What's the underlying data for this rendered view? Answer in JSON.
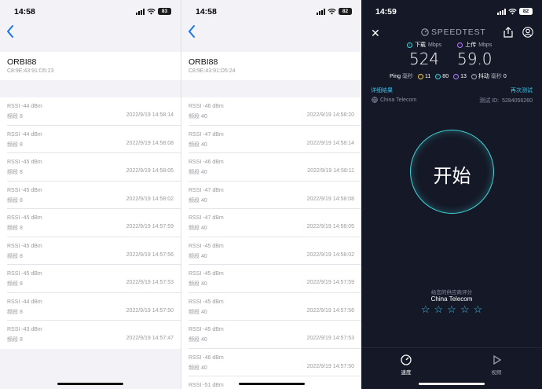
{
  "panel1": {
    "time": "14:58",
    "battery": "83",
    "device_name": "ORBI88",
    "device_mac": "C8:9E:43:91:D5:23",
    "rows": [
      {
        "rssi": "RSSI -44 dBm",
        "band": "频段 8",
        "ts": "2022/9/19 14:58:14"
      },
      {
        "rssi": "RSSI -44 dBm",
        "band": "频段 8",
        "ts": "2022/9/19 14:58:08"
      },
      {
        "rssi": "RSSI -45 dBm",
        "band": "频段 8",
        "ts": "2022/9/19 14:58:05"
      },
      {
        "rssi": "RSSI -45 dBm",
        "band": "频段 8",
        "ts": "2022/9/19 14:58:02"
      },
      {
        "rssi": "RSSI -45 dBm",
        "band": "频段 8",
        "ts": "2022/9/19 14:57:59"
      },
      {
        "rssi": "RSSI -45 dBm",
        "band": "频段 8",
        "ts": "2022/9/19 14:57:56"
      },
      {
        "rssi": "RSSI -45 dBm",
        "band": "频段 8",
        "ts": "2022/9/19 14:57:53"
      },
      {
        "rssi": "RSSI -44 dBm",
        "band": "频段 8",
        "ts": "2022/9/19 14:57:50"
      },
      {
        "rssi": "RSSI -43 dBm",
        "band": "频段 8",
        "ts": "2022/9/19 14:57:47"
      }
    ]
  },
  "panel2": {
    "time": "14:58",
    "battery": "82",
    "device_name": "ORBI88",
    "device_mac": "C8:9E:43:91:D5:24",
    "rows": [
      {
        "rssi": "RSSI -46 dBm",
        "band": "频段 40",
        "ts": "2022/9/19 14:58:20"
      },
      {
        "rssi": "RSSI -47 dBm",
        "band": "频段 40",
        "ts": "2022/9/19 14:58:14"
      },
      {
        "rssi": "RSSI -46 dBm",
        "band": "频段 40",
        "ts": "2022/9/19 14:58:11"
      },
      {
        "rssi": "RSSI -47 dBm",
        "band": "频段 40",
        "ts": "2022/9/19 14:58:08"
      },
      {
        "rssi": "RSSI -47 dBm",
        "band": "频段 40",
        "ts": "2022/9/19 14:58:05"
      },
      {
        "rssi": "RSSI -45 dBm",
        "band": "频段 40",
        "ts": "2022/9/19 14:58:02"
      },
      {
        "rssi": "RSSI -45 dBm",
        "band": "频段 40",
        "ts": "2022/9/19 14:57:59"
      },
      {
        "rssi": "RSSI -45 dBm",
        "band": "频段 40",
        "ts": "2022/9/19 14:57:56"
      },
      {
        "rssi": "RSSI -45 dBm",
        "band": "频段 40",
        "ts": "2022/9/19 14:57:53"
      },
      {
        "rssi": "RSSI -46 dBm",
        "band": "频段 40",
        "ts": "2022/9/19 14:57:50"
      },
      {
        "rssi": "RSSI -51 dBm",
        "band": "",
        "ts": ""
      }
    ]
  },
  "speedtest": {
    "time": "14:59",
    "battery": "82",
    "logo": "SPEEDTEST",
    "download": {
      "label": "下载",
      "unit": "Mbps",
      "value": "524"
    },
    "upload": {
      "label": "上传",
      "unit": "Mbps",
      "value": "59.0"
    },
    "ping": {
      "label": "Ping",
      "unit": "毫秒",
      "idle": "11",
      "down": "80",
      "up": "13"
    },
    "jitter": {
      "label": "抖动",
      "unit": "毫秒",
      "value": "0"
    },
    "details_link": "详细结果",
    "retest_link": "再次测试",
    "isp": "China Telecom",
    "test_id_label": "测试 ID:",
    "test_id": "5284056260",
    "go_label": "开始",
    "rate_prompt": "给您的供应商评分",
    "rate_isp": "China Telecom",
    "stars": [
      "☆",
      "☆",
      "☆",
      "☆",
      "☆"
    ],
    "tabs": {
      "speed": "速度",
      "video": "视频"
    },
    "colors": {
      "accent": "#3fc3e8",
      "ring": "#3fd6d9",
      "background": "#151827"
    }
  }
}
